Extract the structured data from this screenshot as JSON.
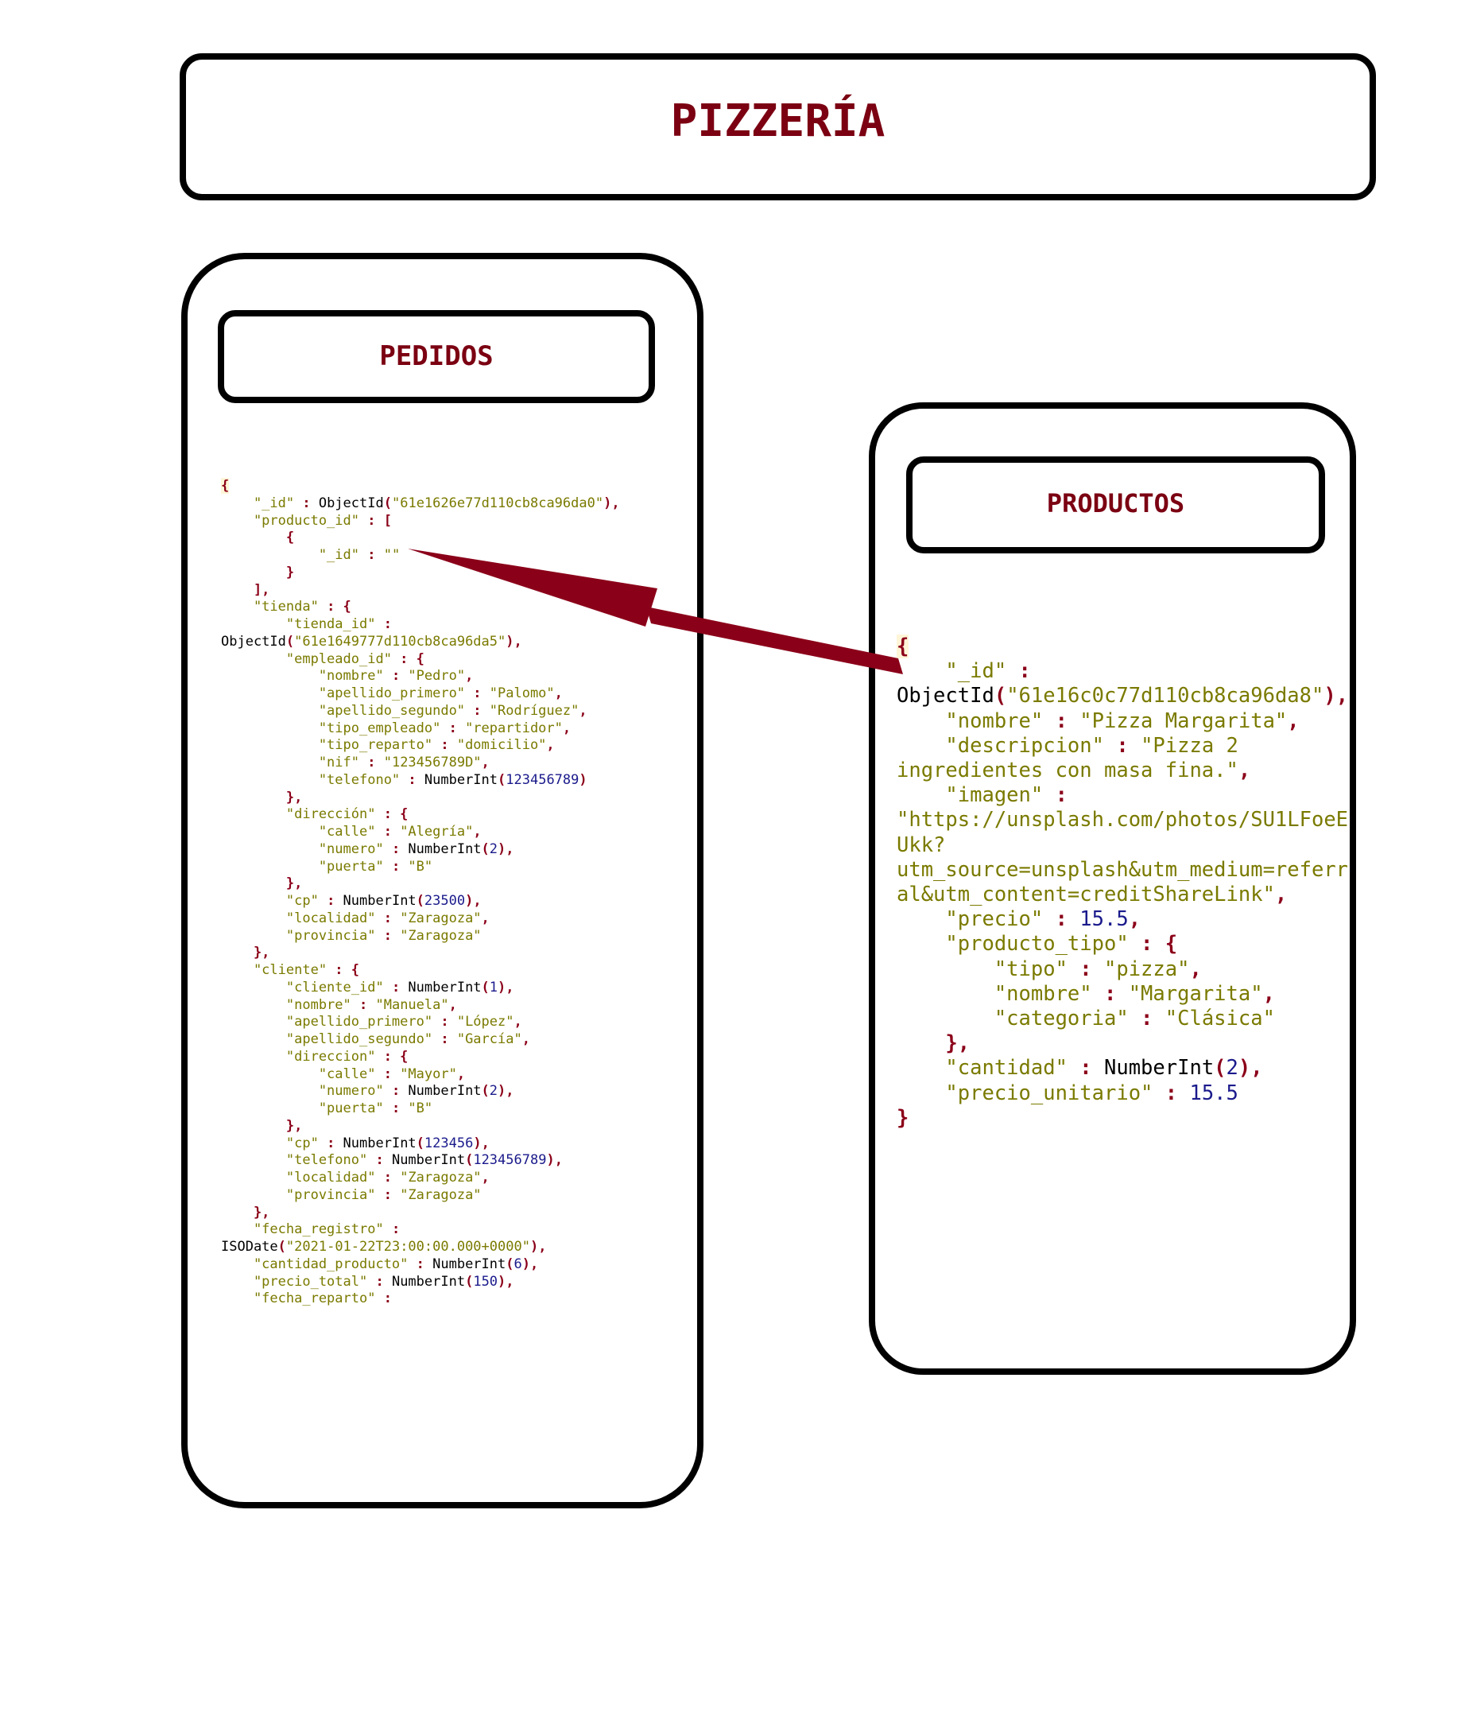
{
  "header": {
    "title": "PIZZERÍA"
  },
  "pedidos": {
    "title": "PEDIDOS",
    "code": [
      [
        [
          "p",
          "{"
        ]
      ],
      [
        [
          "k",
          "    \"_id\""
        ],
        [
          "p",
          " : "
        ],
        [
          "f",
          "ObjectId"
        ],
        [
          "p",
          "("
        ],
        [
          "s",
          "\"61e1626e77d110cb8ca96da0\""
        ],
        [
          "p",
          "),"
        ]
      ],
      [
        [
          "k",
          "    \"producto_id\""
        ],
        [
          "p",
          " : ["
        ]
      ],
      [
        [
          "p",
          "        {"
        ]
      ],
      [
        [
          "k",
          "            \"_id\""
        ],
        [
          "p",
          " : "
        ],
        [
          "s",
          "\"\""
        ]
      ],
      [
        [
          "p",
          "        }"
        ]
      ],
      [
        [
          "p",
          "    ],"
        ]
      ],
      [
        [
          "k",
          "    \"tienda\""
        ],
        [
          "p",
          " : {"
        ]
      ],
      [
        [
          "k",
          "        \"tienda_id\""
        ],
        [
          "p",
          " :"
        ]
      ],
      [
        [
          "f",
          "ObjectId"
        ],
        [
          "p",
          "("
        ],
        [
          "s",
          "\"61e1649777d110cb8ca96da5\""
        ],
        [
          "p",
          "),"
        ]
      ],
      [
        [
          "k",
          "        \"empleado_id\""
        ],
        [
          "p",
          " : {"
        ]
      ],
      [
        [
          "k",
          "            \"nombre\""
        ],
        [
          "p",
          " : "
        ],
        [
          "s",
          "\"Pedro\""
        ],
        [
          "p",
          ","
        ]
      ],
      [
        [
          "k",
          "            \"apellido_primero\""
        ],
        [
          "p",
          " : "
        ],
        [
          "s",
          "\"Palomo\""
        ],
        [
          "p",
          ","
        ]
      ],
      [
        [
          "k",
          "            \"apellido_segundo\""
        ],
        [
          "p",
          " : "
        ],
        [
          "s",
          "\"Rodríguez\""
        ],
        [
          "p",
          ","
        ]
      ],
      [
        [
          "k",
          "            \"tipo_empleado\""
        ],
        [
          "p",
          " : "
        ],
        [
          "s",
          "\"repartidor\""
        ],
        [
          "p",
          ","
        ]
      ],
      [
        [
          "k",
          "            \"tipo_reparto\""
        ],
        [
          "p",
          " : "
        ],
        [
          "s",
          "\"domicilio\""
        ],
        [
          "p",
          ","
        ]
      ],
      [
        [
          "k",
          "            \"nif\""
        ],
        [
          "p",
          " : "
        ],
        [
          "s",
          "\"123456789D\""
        ],
        [
          "p",
          ","
        ]
      ],
      [
        [
          "k",
          "            \"telefono\""
        ],
        [
          "p",
          " : "
        ],
        [
          "f",
          "NumberInt"
        ],
        [
          "p",
          "("
        ],
        [
          "n",
          "123456789"
        ],
        [
          "p",
          ")"
        ]
      ],
      [
        [
          "p",
          "        },"
        ]
      ],
      [
        [
          "k",
          "        \"dirección\""
        ],
        [
          "p",
          " : {"
        ]
      ],
      [
        [
          "k",
          "            \"calle\""
        ],
        [
          "p",
          " : "
        ],
        [
          "s",
          "\"Alegría\""
        ],
        [
          "p",
          ","
        ]
      ],
      [
        [
          "k",
          "            \"numero\""
        ],
        [
          "p",
          " : "
        ],
        [
          "f",
          "NumberInt"
        ],
        [
          "p",
          "("
        ],
        [
          "n",
          "2"
        ],
        [
          "p",
          "),"
        ]
      ],
      [
        [
          "k",
          "            \"puerta\""
        ],
        [
          "p",
          " : "
        ],
        [
          "s",
          "\"B\""
        ]
      ],
      [
        [
          "p",
          "        },"
        ]
      ],
      [
        [
          "k",
          "        \"cp\""
        ],
        [
          "p",
          " : "
        ],
        [
          "f",
          "NumberInt"
        ],
        [
          "p",
          "("
        ],
        [
          "n",
          "23500"
        ],
        [
          "p",
          "),"
        ]
      ],
      [
        [
          "k",
          "        \"localidad\""
        ],
        [
          "p",
          " : "
        ],
        [
          "s",
          "\"Zaragoza\""
        ],
        [
          "p",
          ","
        ]
      ],
      [
        [
          "k",
          "        \"provincia\""
        ],
        [
          "p",
          " : "
        ],
        [
          "s",
          "\"Zaragoza\""
        ]
      ],
      [
        [
          "p",
          "    },"
        ]
      ],
      [
        [
          "k",
          "    \"cliente\""
        ],
        [
          "p",
          " : {"
        ]
      ],
      [
        [
          "k",
          "        \"cliente_id\""
        ],
        [
          "p",
          " : "
        ],
        [
          "f",
          "NumberInt"
        ],
        [
          "p",
          "("
        ],
        [
          "n",
          "1"
        ],
        [
          "p",
          "),"
        ]
      ],
      [
        [
          "k",
          "        \"nombre\""
        ],
        [
          "p",
          " : "
        ],
        [
          "s",
          "\"Manuela\""
        ],
        [
          "p",
          ","
        ]
      ],
      [
        [
          "k",
          "        \"apellido_primero\""
        ],
        [
          "p",
          " : "
        ],
        [
          "s",
          "\"López\""
        ],
        [
          "p",
          ","
        ]
      ],
      [
        [
          "k",
          "        \"apellido_segundo\""
        ],
        [
          "p",
          " : "
        ],
        [
          "s",
          "\"García\""
        ],
        [
          "p",
          ","
        ]
      ],
      [
        [
          "k",
          "        \"direccion\""
        ],
        [
          "p",
          " : {"
        ]
      ],
      [
        [
          "k",
          "            \"calle\""
        ],
        [
          "p",
          " : "
        ],
        [
          "s",
          "\"Mayor\""
        ],
        [
          "p",
          ","
        ]
      ],
      [
        [
          "k",
          "            \"numero\""
        ],
        [
          "p",
          " : "
        ],
        [
          "f",
          "NumberInt"
        ],
        [
          "p",
          "("
        ],
        [
          "n",
          "2"
        ],
        [
          "p",
          "),"
        ]
      ],
      [
        [
          "k",
          "            \"puerta\""
        ],
        [
          "p",
          " : "
        ],
        [
          "s",
          "\"B\""
        ]
      ],
      [
        [
          "p",
          "        },"
        ]
      ],
      [
        [
          "k",
          "        \"cp\""
        ],
        [
          "p",
          " : "
        ],
        [
          "f",
          "NumberInt"
        ],
        [
          "p",
          "("
        ],
        [
          "n",
          "123456"
        ],
        [
          "p",
          "),"
        ]
      ],
      [
        [
          "k",
          "        \"telefono\""
        ],
        [
          "p",
          " : "
        ],
        [
          "f",
          "NumberInt"
        ],
        [
          "p",
          "("
        ],
        [
          "n",
          "123456789"
        ],
        [
          "p",
          "),"
        ]
      ],
      [
        [
          "k",
          "        \"localidad\""
        ],
        [
          "p",
          " : "
        ],
        [
          "s",
          "\"Zaragoza\""
        ],
        [
          "p",
          ","
        ]
      ],
      [
        [
          "k",
          "        \"provincia\""
        ],
        [
          "p",
          " : "
        ],
        [
          "s",
          "\"Zaragoza\""
        ]
      ],
      [
        [
          "p",
          "    },"
        ]
      ],
      [
        [
          "k",
          "    \"fecha_registro\""
        ],
        [
          "p",
          " :"
        ]
      ],
      [
        [
          "f",
          "ISODate"
        ],
        [
          "p",
          "("
        ],
        [
          "s",
          "\"2021-01-22T23:00:00.000+0000\""
        ],
        [
          "p",
          "),"
        ]
      ],
      [
        [
          "k",
          "    \"cantidad_producto\""
        ],
        [
          "p",
          " : "
        ],
        [
          "f",
          "NumberInt"
        ],
        [
          "p",
          "("
        ],
        [
          "n",
          "6"
        ],
        [
          "p",
          "),"
        ]
      ],
      [
        [
          "k",
          "    \"precio_total\""
        ],
        [
          "p",
          " : "
        ],
        [
          "f",
          "NumberInt"
        ],
        [
          "p",
          "("
        ],
        [
          "n",
          "150"
        ],
        [
          "p",
          "),"
        ]
      ],
      [
        [
          "k",
          "    \"fecha_reparto\""
        ],
        [
          "p",
          " :"
        ]
      ]
    ]
  },
  "productos": {
    "title": "PRODUCTOS",
    "code": [
      [
        [
          "p",
          "{"
        ]
      ],
      [
        [
          "k",
          "    \"_id\""
        ],
        [
          "p",
          " :"
        ]
      ],
      [
        [
          "f",
          "ObjectId"
        ],
        [
          "p",
          "("
        ],
        [
          "s",
          "\"61e16c0c77d110cb8ca96da8\""
        ],
        [
          "p",
          "),"
        ]
      ],
      [
        [
          "k",
          "    \"nombre\""
        ],
        [
          "p",
          " : "
        ],
        [
          "s",
          "\"Pizza Margarita\""
        ],
        [
          "p",
          ","
        ]
      ],
      [
        [
          "k",
          "    \"descripcion\""
        ],
        [
          "p",
          " : "
        ],
        [
          "s",
          "\"Pizza 2"
        ]
      ],
      [
        [
          "s",
          "ingredientes con masa fina.\""
        ],
        [
          "p",
          ","
        ]
      ],
      [
        [
          "k",
          "    \"imagen\""
        ],
        [
          "p",
          " :"
        ]
      ],
      [
        [
          "s",
          "\"https://unsplash.com/photos/SU1LFoeE"
        ]
      ],
      [
        [
          "s",
          "Ukk?"
        ]
      ],
      [
        [
          "s",
          "utm_source=unsplash&utm_medium=referr"
        ]
      ],
      [
        [
          "s",
          "al&utm_content=creditShareLink\""
        ],
        [
          "p",
          ","
        ]
      ],
      [
        [
          "k",
          "    \"precio\""
        ],
        [
          "p",
          " : "
        ],
        [
          "n",
          "15.5"
        ],
        [
          "p",
          ","
        ]
      ],
      [
        [
          "k",
          "    \"producto_tipo\""
        ],
        [
          "p",
          " : {"
        ]
      ],
      [
        [
          "k",
          "        \"tipo\""
        ],
        [
          "p",
          " : "
        ],
        [
          "s",
          "\"pizza\""
        ],
        [
          "p",
          ","
        ]
      ],
      [
        [
          "k",
          "        \"nombre\""
        ],
        [
          "p",
          " : "
        ],
        [
          "s",
          "\"Margarita\""
        ],
        [
          "p",
          ","
        ]
      ],
      [
        [
          "k",
          "        \"categoria\""
        ],
        [
          "p",
          " : "
        ],
        [
          "s",
          "\"Clásica\""
        ]
      ],
      [
        [
          "p",
          "    },"
        ]
      ],
      [
        [
          "k",
          "    \"cantidad\""
        ],
        [
          "p",
          " : "
        ],
        [
          "f",
          "NumberInt"
        ],
        [
          "p",
          "("
        ],
        [
          "n",
          "2"
        ],
        [
          "p",
          "),"
        ]
      ],
      [
        [
          "k",
          "    \"precio_unitario\""
        ],
        [
          "p",
          " : "
        ],
        [
          "n",
          "15.5"
        ]
      ],
      [
        [
          "p",
          "}"
        ]
      ]
    ]
  },
  "colors": {
    "title": "#7b0012",
    "arrow": "#8b0019"
  }
}
